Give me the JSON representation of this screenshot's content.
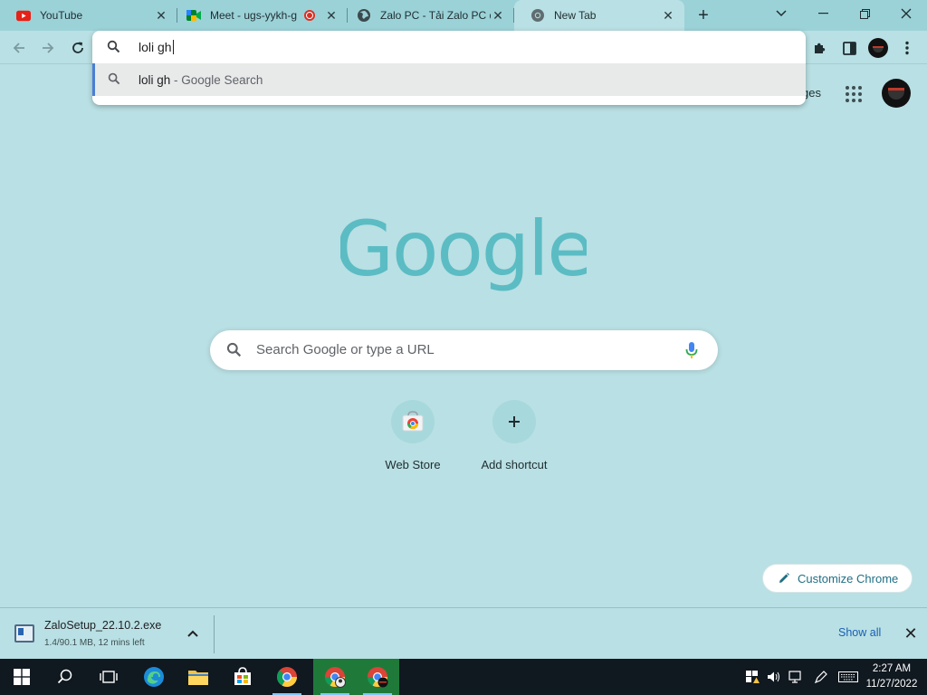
{
  "tabs": [
    {
      "title": "YouTube",
      "icon": "youtube-icon"
    },
    {
      "title": "Meet - ugs-yykh-g",
      "icon": "google-meet-icon",
      "recording": true
    },
    {
      "title": "Zalo PC - Tải Zalo PC d",
      "icon": "globe-icon"
    },
    {
      "title": "New Tab",
      "icon": "chrome-icon",
      "active": true
    }
  ],
  "omnibox": {
    "value": "loli gh",
    "suggestion": {
      "query": "loli gh",
      "suffix": " - Google Search"
    }
  },
  "ntp": {
    "header_link_partial": "ges",
    "search_placeholder": "Search Google or type a URL",
    "shortcuts": [
      {
        "label": "Web Store",
        "icon": "chrome-web-store-icon"
      },
      {
        "label": "Add shortcut",
        "icon": "plus-icon"
      }
    ],
    "customize_label": "Customize Chrome"
  },
  "download": {
    "filename": "ZaloSetup_22.10.2.exe",
    "meta": "1.4/90.1 MB, 12 mins left",
    "show_all": "Show all"
  },
  "clock": {
    "time": "2:27 AM",
    "date": "11/27/2022"
  },
  "colors": {
    "page_bg": "#b9e0e4",
    "tabstrip_bg": "#9bd2d8",
    "logo": "#5bbcc4",
    "taskbar": "#101820"
  }
}
